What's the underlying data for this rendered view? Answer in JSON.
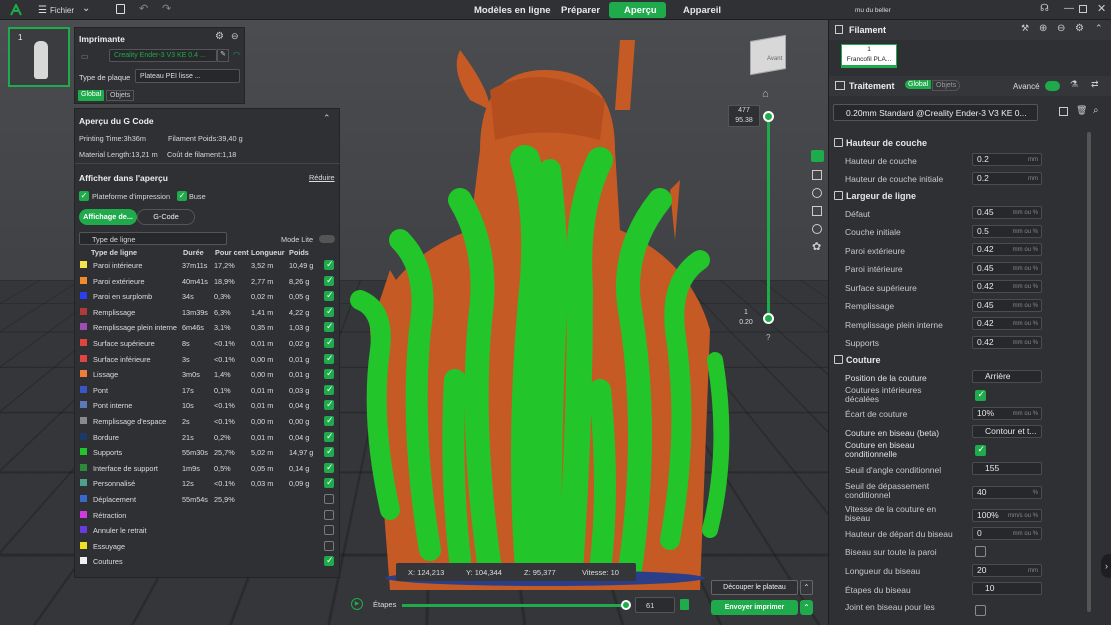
{
  "app": {
    "file_menu": "Fichier",
    "nav_tabs": [
      "Modèles en ligne",
      "Préparer",
      "Aperçu",
      "Appareil"
    ],
    "active_tab": "Aperçu",
    "window_title": "mu du beller"
  },
  "colors": {
    "accent": "#1faa4b",
    "model_orange": "#c65a25",
    "support_green": "#22c52a"
  },
  "plate": {
    "number": "1"
  },
  "printer": {
    "title": "Imprimante",
    "name": "Creality Ender-3 V3 KE 0.4 ...",
    "plate_type_label": "Type de plaque",
    "plate_type_value": "Plateau PEI lisse ...",
    "tab_global": "Global",
    "tab_objects": "Objets"
  },
  "gcode": {
    "title": "Aperçu du G Code",
    "printing_time": "Printing Time:3h36m",
    "filament_weight": "Filament Poids:39,40 g",
    "material_length": "Material Length:13,21 m",
    "filament_cost": "Coût de filament:1,18",
    "display_title": "Afficher dans l'aperçu",
    "reduce": "Réduire",
    "show_platform": "Plateforme d'impression",
    "show_nozzle": "Buse",
    "btn_display": "Affichage de...",
    "btn_gcode": "G-Code",
    "line_type_select": "Type de ligne",
    "lite_mode": "Mode Lite",
    "headers": [
      "Type de ligne",
      "Durée",
      "Pour cent",
      "Longueur",
      "Poids"
    ],
    "rows": [
      {
        "color": "#f4e34a",
        "name": "Paroi intérieure",
        "time": "37m11s",
        "pct": "17,2%",
        "len": "3,52 m",
        "w": "10,49 g",
        "on": true
      },
      {
        "color": "#f08c2c",
        "name": "Paroi extérieure",
        "time": "40m41s",
        "pct": "18,9%",
        "len": "2,77 m",
        "w": "8,26 g",
        "on": true
      },
      {
        "color": "#2a3ff0",
        "name": "Paroi en surplomb",
        "time": "34s",
        "pct": "0,3%",
        "len": "0,02 m",
        "w": "0,05 g",
        "on": true
      },
      {
        "color": "#b03a3a",
        "name": "Remplissage",
        "time": "13m39s",
        "pct": "6,3%",
        "len": "1,41 m",
        "w": "4,22 g",
        "on": true
      },
      {
        "color": "#9b4fb0",
        "name": "Remplissage plein interne",
        "time": "6m46s",
        "pct": "3,1%",
        "len": "0,35 m",
        "w": "1,03 g",
        "on": true
      },
      {
        "color": "#e0443a",
        "name": "Surface supérieure",
        "time": "8s",
        "pct": "<0.1%",
        "len": "0,01 m",
        "w": "0,02 g",
        "on": true
      },
      {
        "color": "#e04545",
        "name": "Surface inférieure",
        "time": "3s",
        "pct": "<0.1%",
        "len": "0,00 m",
        "w": "0,01 g",
        "on": true
      },
      {
        "color": "#f07d3a",
        "name": "Lissage",
        "time": "3m0s",
        "pct": "1,4%",
        "len": "0,00 m",
        "w": "0,01 g",
        "on": true
      },
      {
        "color": "#3b55c8",
        "name": "Pont",
        "time": "17s",
        "pct": "0,1%",
        "len": "0,01 m",
        "w": "0,03 g",
        "on": true
      },
      {
        "color": "#5d78b8",
        "name": "Pont interne",
        "time": "10s",
        "pct": "<0.1%",
        "len": "0,01 m",
        "w": "0,04 g",
        "on": true
      },
      {
        "color": "#8a8a8a",
        "name": "Remplissage d'espace",
        "time": "2s",
        "pct": "<0.1%",
        "len": "0,00 m",
        "w": "0,00 g",
        "on": true
      },
      {
        "color": "#1a3a6a",
        "name": "Bordure",
        "time": "21s",
        "pct": "0,2%",
        "len": "0,01 m",
        "w": "0,04 g",
        "on": true
      },
      {
        "color": "#22c52a",
        "name": "Supports",
        "time": "55m30s",
        "pct": "25,7%",
        "len": "5,02 m",
        "w": "14,97 g",
        "on": true
      },
      {
        "color": "#2c8a3a",
        "name": "Interface de support",
        "time": "1m9s",
        "pct": "0,5%",
        "len": "0,05 m",
        "w": "0,14 g",
        "on": true
      },
      {
        "color": "#4fa08a",
        "name": "Personnalisé",
        "time": "12s",
        "pct": "<0.1%",
        "len": "0,03 m",
        "w": "0,09 g",
        "on": true
      },
      {
        "color": "#3a68c8",
        "name": "Déplacement",
        "time": "55m54s",
        "pct": "25,9%",
        "len": "",
        "w": "",
        "on": false
      },
      {
        "color": "#d03adf",
        "name": "Rétraction",
        "time": "",
        "pct": "",
        "len": "",
        "w": "",
        "on": false
      },
      {
        "color": "#6a3ae0",
        "name": "Annuler le retrait",
        "time": "",
        "pct": "",
        "len": "",
        "w": "",
        "on": false
      },
      {
        "color": "#f0e020",
        "name": "Essuyage",
        "time": "",
        "pct": "",
        "len": "",
        "w": "",
        "on": false
      },
      {
        "color": "#f0f0f0",
        "name": "Coutures",
        "time": "",
        "pct": "",
        "len": "",
        "w": "",
        "on": true
      }
    ]
  },
  "viewport": {
    "layer_top": "477",
    "layer_top_h": "95.38",
    "layer_bottom": "1",
    "layer_bottom_h": "0.20",
    "help": "?",
    "coords": {
      "x": "X: 124,213",
      "y": "Y: 104,344",
      "z": "Z: 95,377",
      "speed": "Vitesse: 10"
    },
    "cube_label": "Avant",
    "slice_btn": "Découper le plateau",
    "send_btn": "Envoyer imprimer",
    "steps_label": "Étapes",
    "steps_value": "61"
  },
  "right": {
    "filament_title": "Filament",
    "filament_slot_num": "1",
    "filament_slot_name": "Francofil PLA...",
    "process_title": "Traitement",
    "tab_global": "Global",
    "tab_objects": "Objets",
    "advanced": "Avancé",
    "profile": "0.20mm Standard @Creality Ender-3 V3 KE 0...",
    "sec_layer": "Hauteur de couche",
    "layer_height": "Hauteur de couche",
    "layer_height_v": "0.2",
    "mm": "mm",
    "first_layer": "Hauteur de couche initiale",
    "first_layer_v": "0.2",
    "sec_width": "Largeur de ligne",
    "w_default": "Défaut",
    "w_default_v": "0.45",
    "unit_mm_pct": "mm ou %",
    "w_first": "Couche initiale",
    "w_first_v": "0.5",
    "w_outer": "Paroi extérieure",
    "w_outer_v": "0.42",
    "w_inner": "Paroi intérieure",
    "w_inner_v": "0.45",
    "w_top": "Surface supérieure",
    "w_top_v": "0.42",
    "w_infill": "Remplissage",
    "w_infill_v": "0.45",
    "w_solid": "Remplissage plein interne",
    "w_solid_v": "0.42",
    "w_support": "Supports",
    "w_support_v": "0.42",
    "sec_seam": "Couture",
    "seam_pos": "Position de la couture",
    "seam_pos_v": "Arrière",
    "seam_inner": "Coutures intérieures décalées",
    "seam_gap": "Écart de couture",
    "seam_gap_v": "10%",
    "scarf": "Couture en biseau (beta)",
    "scarf_v": "Contour et t...",
    "scarf_cond": "Couture en biseau conditionnelle",
    "angle_thr": "Seuil d'angle conditionnel",
    "angle_thr_v": "155",
    "overhang_thr": "Seuil de dépassement conditionnel",
    "overhang_thr_v": "40",
    "pct": "%",
    "scarf_speed": "Vitesse de la couture en biseau",
    "scarf_speed_v": "100%",
    "speed_unit": "mm/s ou %",
    "scarf_start": "Hauteur de départ du biseau",
    "scarf_start_v": "0",
    "scarf_all": "Biseau sur toute la paroi",
    "scarf_len": "Longueur du biseau",
    "scarf_len_v": "20",
    "scarf_steps": "Étapes du biseau",
    "scarf_steps_v": "10",
    "scarf_joint": "Joint en biseau pour les"
  }
}
